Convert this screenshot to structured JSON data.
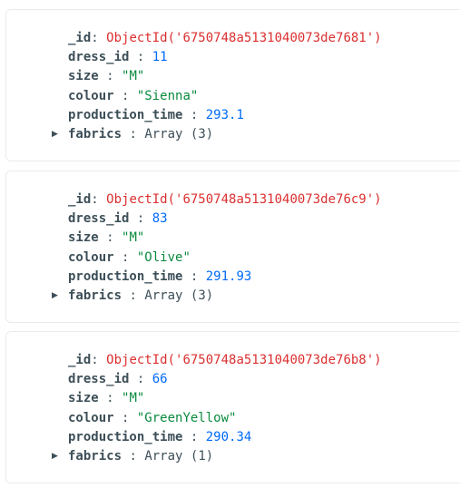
{
  "documents": [
    {
      "fields": [
        {
          "key": "_id",
          "sep": ": ",
          "value": "ObjectId('6750748a5131040073de7681')",
          "type": "objectid"
        },
        {
          "key": "dress_id",
          "sep": " : ",
          "value": "11",
          "type": "number"
        },
        {
          "key": "size",
          "sep": " : ",
          "value": "\"M\"",
          "type": "string"
        },
        {
          "key": "colour",
          "sep": " : ",
          "value": "\"Sienna\"",
          "type": "string"
        },
        {
          "key": "production_time",
          "sep": " : ",
          "value": "293.1",
          "type": "number"
        },
        {
          "key": "fabrics",
          "sep": " : ",
          "value": "Array (3)",
          "type": "array",
          "expandable": true
        }
      ]
    },
    {
      "fields": [
        {
          "key": "_id",
          "sep": ": ",
          "value": "ObjectId('6750748a5131040073de76c9')",
          "type": "objectid"
        },
        {
          "key": "dress_id",
          "sep": " : ",
          "value": "83",
          "type": "number"
        },
        {
          "key": "size",
          "sep": " : ",
          "value": "\"M\"",
          "type": "string"
        },
        {
          "key": "colour",
          "sep": " : ",
          "value": "\"Olive\"",
          "type": "string"
        },
        {
          "key": "production_time",
          "sep": " : ",
          "value": "291.93",
          "type": "number"
        },
        {
          "key": "fabrics",
          "sep": " : ",
          "value": "Array (3)",
          "type": "array",
          "expandable": true
        }
      ]
    },
    {
      "fields": [
        {
          "key": "_id",
          "sep": ": ",
          "value": "ObjectId('6750748a5131040073de76b8')",
          "type": "objectid"
        },
        {
          "key": "dress_id",
          "sep": " : ",
          "value": "66",
          "type": "number"
        },
        {
          "key": "size",
          "sep": " : ",
          "value": "\"M\"",
          "type": "string"
        },
        {
          "key": "colour",
          "sep": " : ",
          "value": "\"GreenYellow\"",
          "type": "string"
        },
        {
          "key": "production_time",
          "sep": " : ",
          "value": "290.34",
          "type": "number"
        },
        {
          "key": "fabrics",
          "sep": " : ",
          "value": "Array (1)",
          "type": "array",
          "expandable": true
        }
      ]
    }
  ],
  "icons": {
    "expander": "caret-right-icon",
    "expander_glyph": "▶"
  }
}
